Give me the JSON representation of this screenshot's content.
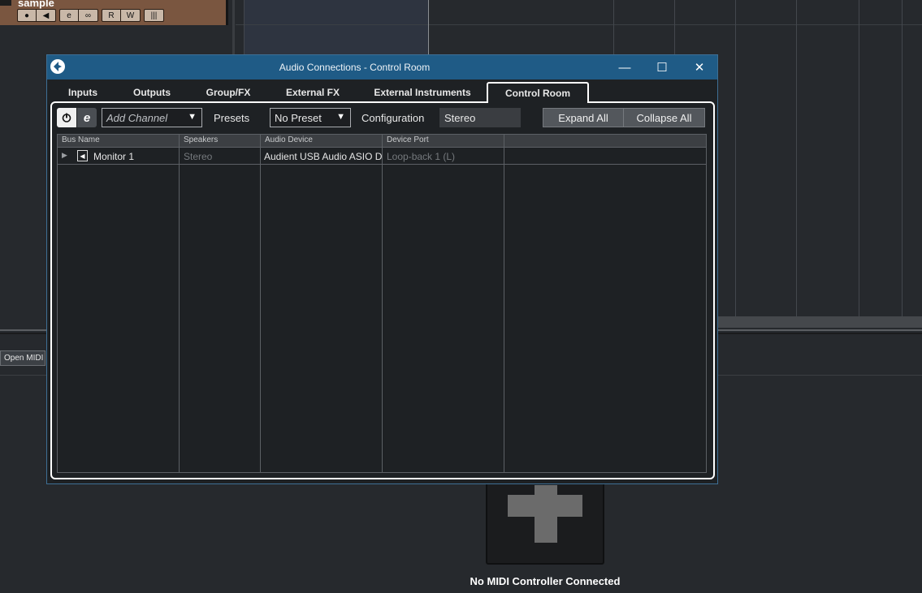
{
  "track": {
    "name": "sample",
    "buttons": [
      "●",
      "◀",
      "e",
      "∞",
      "R",
      "W",
      "|||"
    ]
  },
  "open_midi_label": "Open MIDI",
  "midi_placeholder": {
    "label": "No MIDI Controller Connected",
    "icon": "plus-icon"
  },
  "dialog": {
    "title": "Audio Connections - Control Room",
    "window_buttons": {
      "minimize": "—",
      "maximize": "☐",
      "close": "✕"
    },
    "tabs": [
      "Inputs",
      "Outputs",
      "Group/FX",
      "External FX",
      "External Instruments",
      "Control Room"
    ],
    "active_tab": "Control Room",
    "toolbar": {
      "add_channel": "Add Channel",
      "presets_label": "Presets",
      "preset_value": "No Preset",
      "configuration_label": "Configuration",
      "configuration_value": "Stereo",
      "expand_all": "Expand All",
      "collapse_all": "Collapse All"
    },
    "table": {
      "columns": [
        "Bus Name",
        "Speakers",
        "Audio Device",
        "Device Port"
      ],
      "rows": [
        {
          "bus_name": "Monitor 1",
          "speakers": "Stereo",
          "audio_device": "Audient USB Audio ASIO Dr",
          "device_port": "Loop-back 1 (L)"
        }
      ]
    }
  },
  "colors": {
    "titlebar": "#1f5b86",
    "track": "#7a5640",
    "panel_border": "#ffffff"
  }
}
